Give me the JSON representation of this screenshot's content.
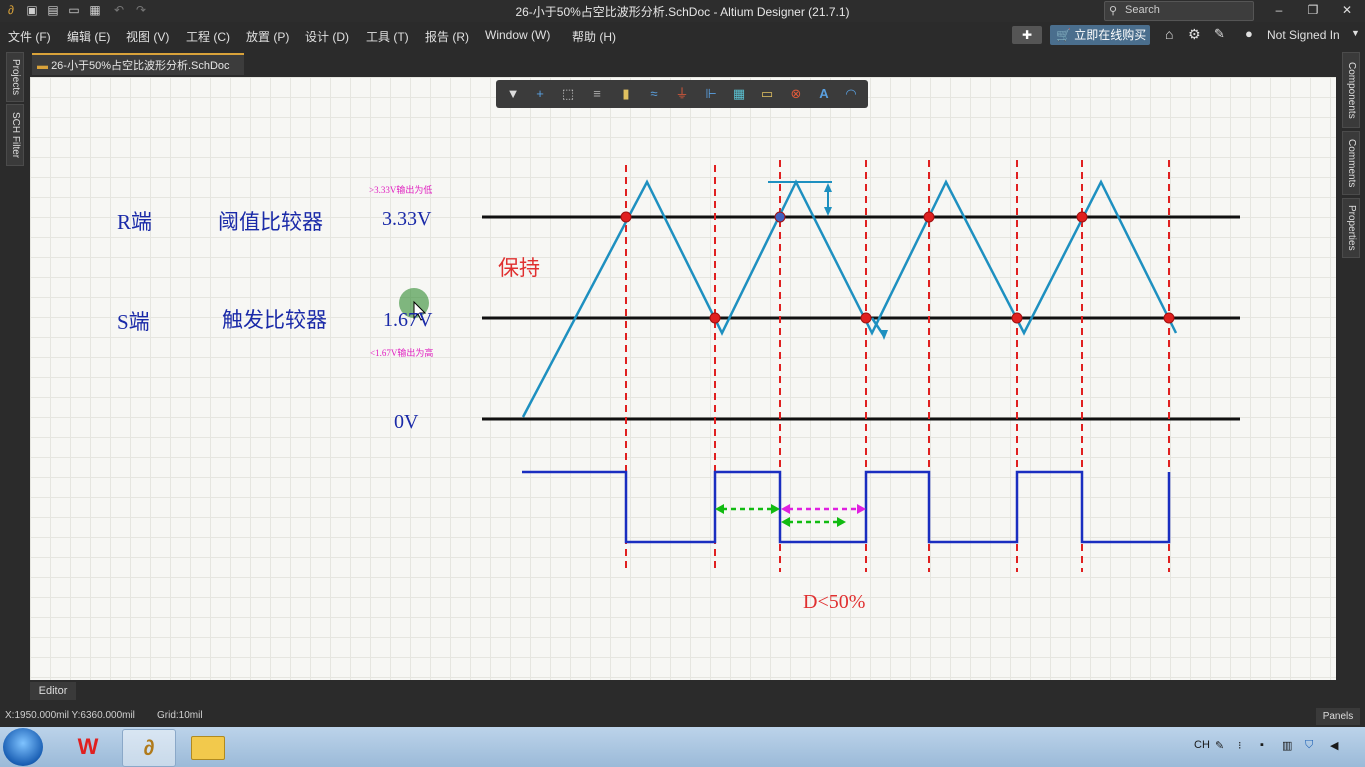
{
  "window": {
    "title": "26-小于50%占空比波形分析.SchDoc - Altium Designer (21.7.1)",
    "search_placeholder": "Search"
  },
  "menu": {
    "items": [
      "文件 (F)",
      "编辑 (E)",
      "视图 (V)",
      "工程 (C)",
      "放置 (P)",
      "设计 (D)",
      "工具 (T)",
      "报告 (R)",
      "Window (W)",
      "帮助 (H)"
    ],
    "buy_button": "立即在线购买",
    "user": "Not Signed In"
  },
  "document_tab": {
    "label": "26-小于50%占空比波形分析.SchDoc"
  },
  "left_panels": [
    "Projects",
    "SCH Filter"
  ],
  "right_panels": [
    "Components",
    "Comments",
    "Properties"
  ],
  "toolbar_icons": [
    "filter-icon",
    "add-icon",
    "select-rect-icon",
    "align-icon",
    "part-icon",
    "bus-icon",
    "ground-icon",
    "net-label-icon",
    "harness-icon",
    "port-icon",
    "directive-icon",
    "text-icon",
    "arc-icon"
  ],
  "diagram": {
    "r_label": "R端",
    "r_desc": "阈值比较器",
    "r_level": "3.33V",
    "r_note": ">3.33V输出为低",
    "s_label": "S端",
    "s_desc": "触发比较器",
    "s_level": "1.67V",
    "s_note": "<1.67V输出为高",
    "zero_level": "0V",
    "hold_label": "保持",
    "duty_label": "D<50%",
    "colors": {
      "triangle": "#1e90c0",
      "square": "#1a2ec0",
      "marker": "#e02020",
      "dash": "#e02020",
      "green": "#11bb11",
      "magenta": "#e020e0",
      "text_blue": "#1a2aa8",
      "hold": "#e03030"
    }
  },
  "editor_tab": "Editor",
  "status": {
    "coords": "X:1950.000mil Y:6360.000mil",
    "grid": "Grid:10mil",
    "panels": "Panels"
  },
  "taskbar": {
    "tray_lang": "CH"
  }
}
